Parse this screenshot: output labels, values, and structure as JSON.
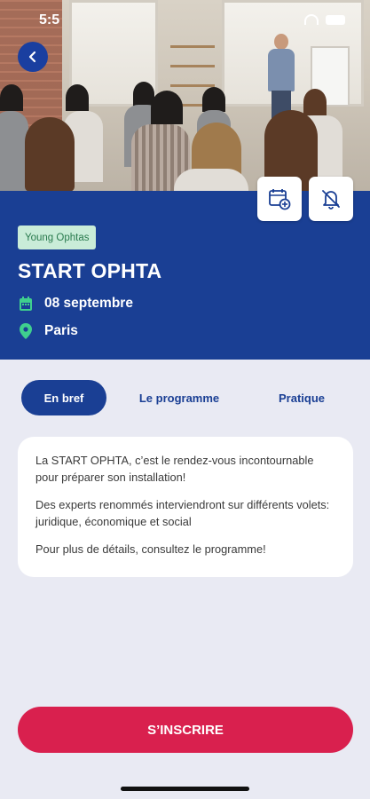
{
  "status_bar": {
    "time": "5:5"
  },
  "event": {
    "tag": "Young Ophtas",
    "title": "START OPHTA",
    "date": "08 septembre",
    "place": "Paris"
  },
  "tabs": [
    {
      "label": "En bref",
      "active": true
    },
    {
      "label": "Le programme",
      "active": false
    },
    {
      "label": "Pratique",
      "active": false
    }
  ],
  "summary": {
    "paragraphs": [
      "La START OPHTA, c’est le rendez-vous incontournable pour préparer son installation!",
      "Des experts renommés interviendront sur différents volets: juridique, économique et social",
      "Pour plus de détails, consultez le programme!"
    ]
  },
  "cta": {
    "label": "S’INSCRIRE"
  },
  "colors": {
    "primary_blue": "#1a3f94",
    "cta_red": "#d9204e",
    "tag_green_bg": "#c9ecd8",
    "tag_green_text": "#2a7a4e",
    "background": "#e9eaf3"
  },
  "icons": {
    "back": "chevron-left-icon",
    "add_calendar": "calendar-add-icon",
    "notifications_off": "bell-off-icon",
    "date": "calendar-icon",
    "place": "location-pin-icon"
  }
}
